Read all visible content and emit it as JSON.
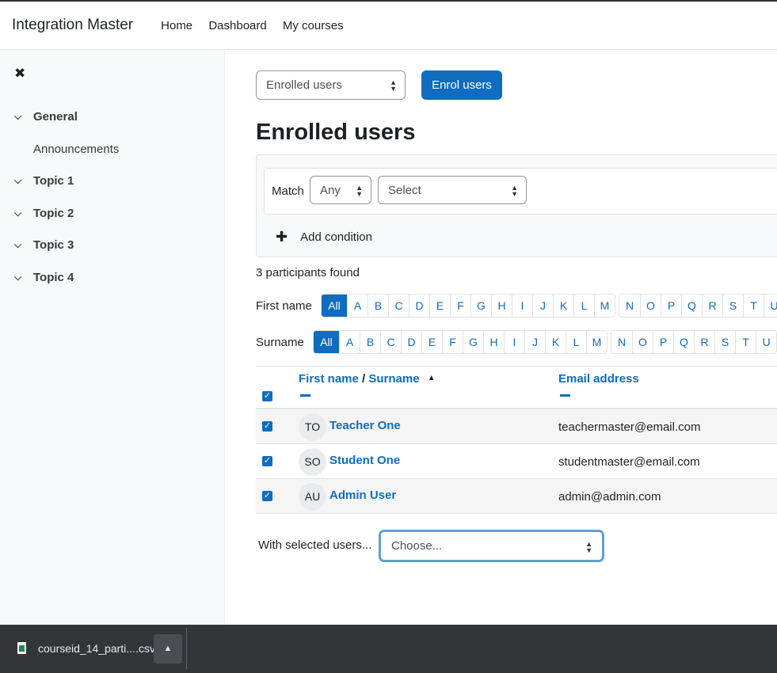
{
  "header": {
    "brand": "Integration Master",
    "nav": [
      "Home",
      "Dashboard",
      "My courses"
    ]
  },
  "drawer": {
    "close_icon": "close-icon",
    "sections": [
      {
        "label": "General",
        "children": [
          "Announcements"
        ]
      },
      {
        "label": "Topic 1"
      },
      {
        "label": "Topic 2"
      },
      {
        "label": "Topic 3"
      },
      {
        "label": "Topic 4"
      }
    ]
  },
  "main": {
    "view_select": "Enrolled users",
    "enrol_button": "Enrol users",
    "title": "Enrolled users",
    "filter": {
      "match_label": "Match",
      "match_value": "Any",
      "condition_value": "Select",
      "add_condition": "Add condition"
    },
    "found": "3 participants found",
    "firstname_label": "First name",
    "surname_label": "Surname",
    "all_label": "All",
    "letters_a": [
      "A",
      "B",
      "C",
      "D",
      "E",
      "F",
      "G",
      "H",
      "I",
      "J",
      "K",
      "L",
      "M"
    ],
    "letters_b": [
      "N",
      "O",
      "P",
      "Q",
      "R",
      "S",
      "T",
      "U"
    ],
    "table": {
      "col_first": "First name",
      "col_sep": " / ",
      "col_surname": "Surname",
      "col_email": "Email address",
      "rows": [
        {
          "initials": "TO",
          "name": "Teacher One",
          "email": "teachermaster@email.com"
        },
        {
          "initials": "SO",
          "name": "Student One",
          "email": "studentmaster@email.com"
        },
        {
          "initials": "AU",
          "name": "Admin User",
          "email": "admin@admin.com"
        }
      ]
    },
    "with_selected_label": "With selected users...",
    "with_selected_value": "Choose..."
  },
  "download_bar": {
    "filename": "courseid_14_parti....csv"
  },
  "colors": {
    "primary": "#0f6cbf",
    "focus_ring": "#5e9ed6",
    "download_bar": "#333639"
  }
}
